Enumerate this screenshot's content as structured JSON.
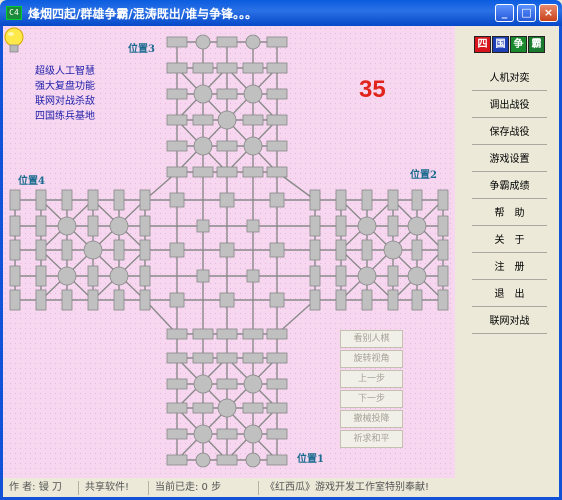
{
  "window": {
    "title": "烽烟四起/群雄争霸/混涛既出/谁与争锋。。。",
    "icon": "app-icon",
    "icon_text": "C4"
  },
  "board": {
    "positions": [
      "位置1",
      "位置2",
      "位置3",
      "位置4"
    ],
    "features": [
      "超级人工智慧",
      "强大复盘功能",
      "联网对战杀敌",
      "四国练兵基地"
    ],
    "counter": "35",
    "controls": [
      "看别人棋",
      "旋转视角",
      "上一步",
      "下一步",
      "撤械投降",
      "祈求和平"
    ]
  },
  "menu": {
    "logo": [
      "四",
      "国",
      "争",
      "霸"
    ],
    "logo_colors": [
      "#d8141d",
      "#1f3fb5",
      "#1a8a2e",
      "#1a7a2e"
    ],
    "items": [
      "人机对奕",
      "调出战役",
      "保存战役",
      "游戏设置",
      "争霸成绩",
      "帮　助",
      "关　于",
      "注　册",
      "退　出",
      "联网对战"
    ]
  },
  "statusbar": {
    "author": "作 者: 锓 刀",
    "share": "共享软件!",
    "moves": "当前已走: 0 步",
    "credit": "《红西瓜》游戏开发工作室特别奉献!"
  },
  "colors": {
    "board_bg": "#f7d7f0",
    "node": "#c0c0c0",
    "line": "#8a8a8a",
    "accent": "#e0241c"
  }
}
